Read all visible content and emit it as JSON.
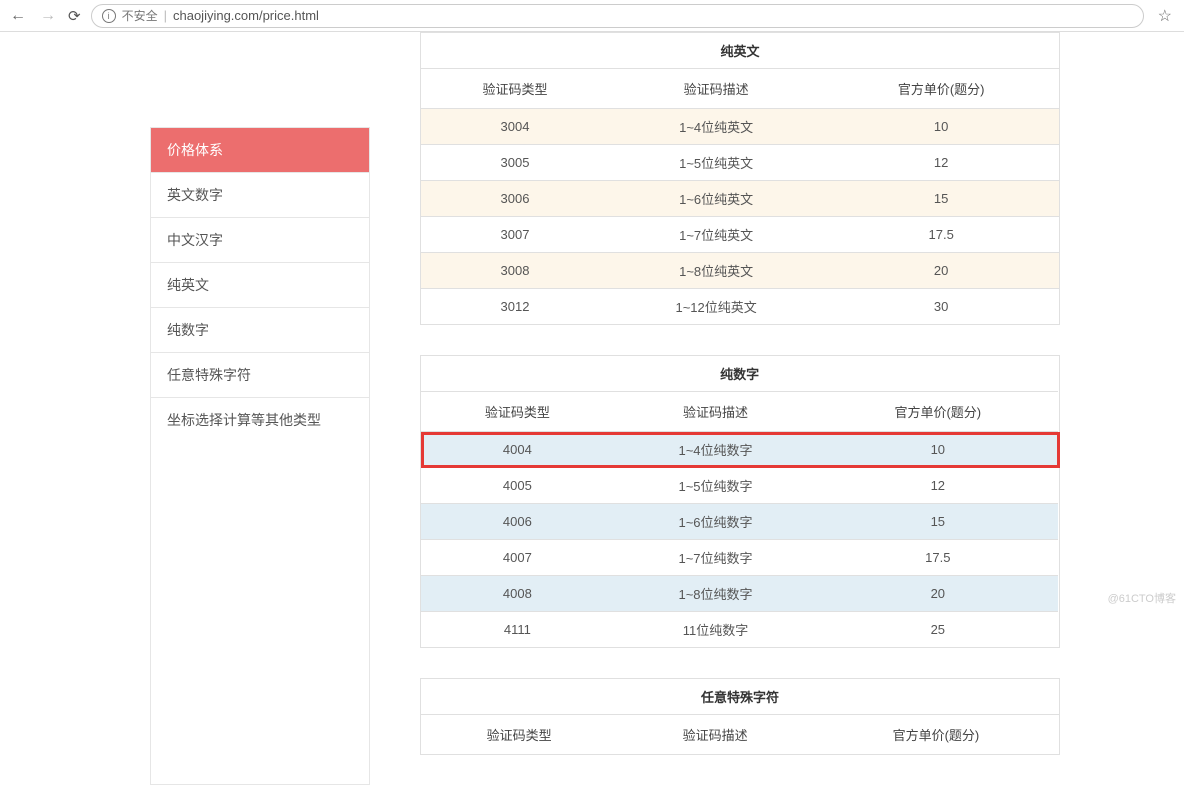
{
  "browser": {
    "insecure_label": "不安全",
    "url": "chaojiying.com/price.html"
  },
  "sidebar": {
    "items": [
      {
        "label": "价格体系",
        "active": true
      },
      {
        "label": "英文数字",
        "active": false
      },
      {
        "label": "中文汉字",
        "active": false
      },
      {
        "label": "纯英文",
        "active": false
      },
      {
        "label": "纯数字",
        "active": false
      },
      {
        "label": "任意特殊字符",
        "active": false
      },
      {
        "label": "坐标选择计算等其他类型",
        "active": false
      }
    ]
  },
  "headers": {
    "type": "验证码类型",
    "desc": "验证码描述",
    "price": "官方单价(题分)"
  },
  "tables": [
    {
      "title": "纯英文",
      "style": "english",
      "highlight_index": -1,
      "rows": [
        {
          "type": "3004",
          "desc": "1~4位纯英文",
          "price": "10"
        },
        {
          "type": "3005",
          "desc": "1~5位纯英文",
          "price": "12"
        },
        {
          "type": "3006",
          "desc": "1~6位纯英文",
          "price": "15"
        },
        {
          "type": "3007",
          "desc": "1~7位纯英文",
          "price": "17.5"
        },
        {
          "type": "3008",
          "desc": "1~8位纯英文",
          "price": "20"
        },
        {
          "type": "3012",
          "desc": "1~12位纯英文",
          "price": "30"
        }
      ]
    },
    {
      "title": "纯数字",
      "style": "number",
      "highlight_index": 0,
      "rows": [
        {
          "type": "4004",
          "desc": "1~4位纯数字",
          "price": "10"
        },
        {
          "type": "4005",
          "desc": "1~5位纯数字",
          "price": "12"
        },
        {
          "type": "4006",
          "desc": "1~6位纯数字",
          "price": "15"
        },
        {
          "type": "4007",
          "desc": "1~7位纯数字",
          "price": "17.5"
        },
        {
          "type": "4008",
          "desc": "1~8位纯数字",
          "price": "20"
        },
        {
          "type": "4111",
          "desc": "11位纯数字",
          "price": "25"
        }
      ]
    },
    {
      "title": "任意特殊字符",
      "style": "plain",
      "highlight_index": -1,
      "rows": []
    }
  ],
  "watermark": "@61CTO博客"
}
